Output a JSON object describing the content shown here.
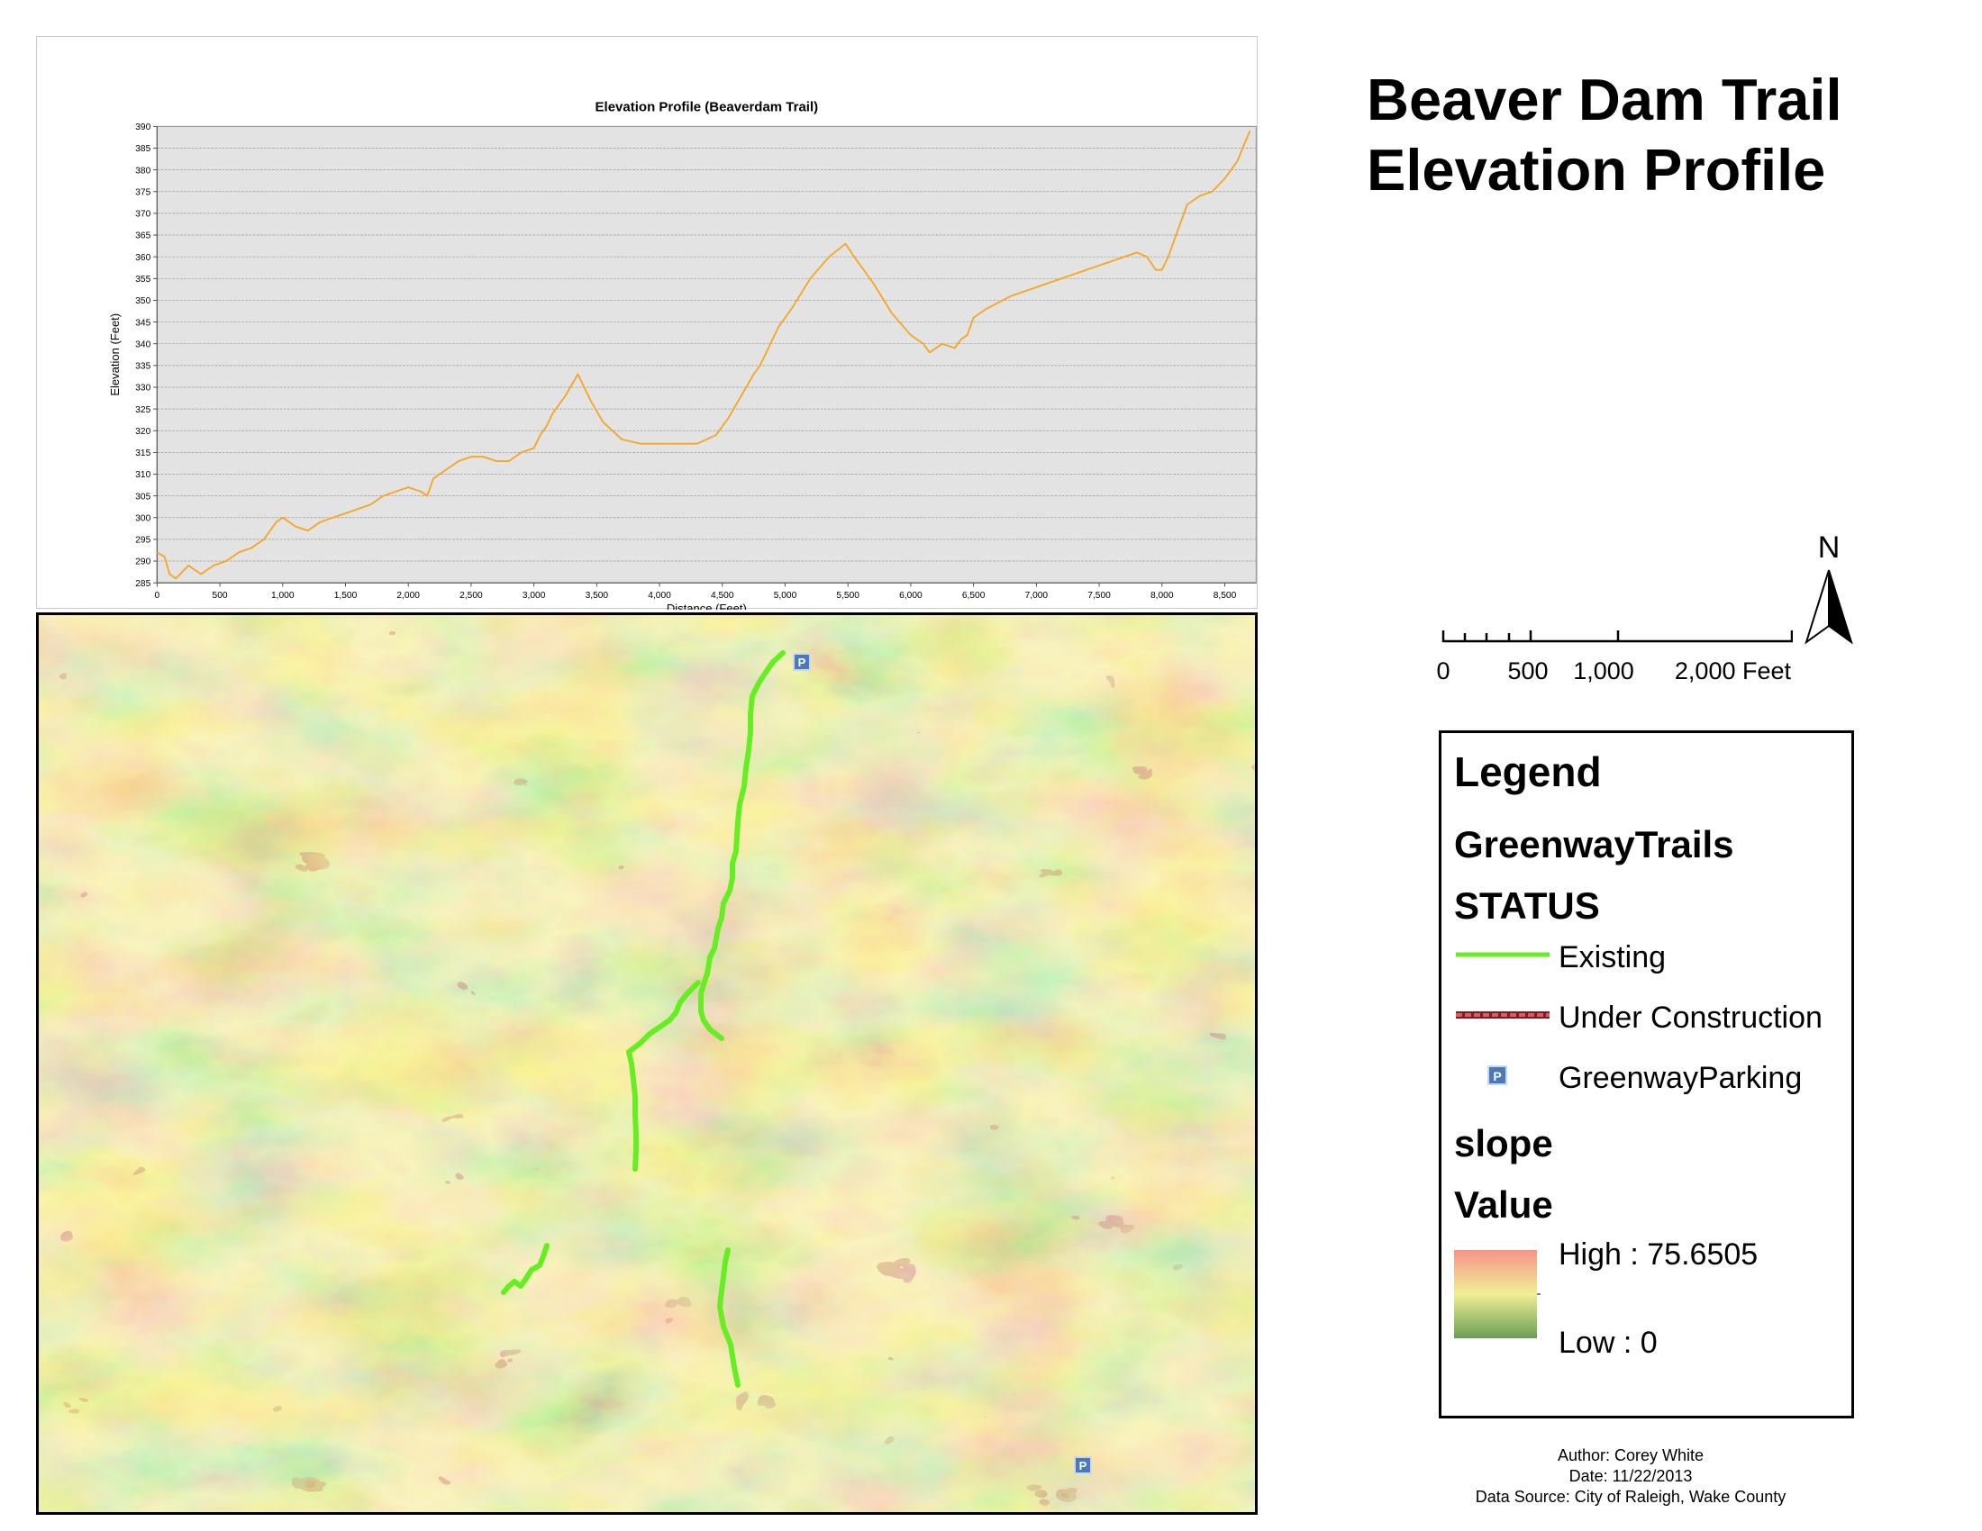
{
  "title": {
    "line1": "Beaver Dam Trail",
    "line2": "Elevation Profile"
  },
  "chart_data": {
    "type": "line",
    "title": "Elevation Profile (Beaverdam Trail)",
    "xlabel": "Distance (Feet)",
    "ylabel": "Elevation (Feet)",
    "xlim": [
      0,
      8750
    ],
    "ylim": [
      285,
      390
    ],
    "xticks": [
      0,
      500,
      1000,
      1500,
      2000,
      2500,
      3000,
      3500,
      4000,
      4500,
      5000,
      5500,
      6000,
      6500,
      7000,
      7500,
      8000,
      8500
    ],
    "xtick_labels": [
      "0",
      "500",
      "1,000",
      "1,500",
      "2,000",
      "2,500",
      "3,000",
      "3,500",
      "4,000",
      "4,500",
      "5,000",
      "5,500",
      "6,000",
      "6,500",
      "7,000",
      "7,500",
      "8,000",
      "8,500"
    ],
    "yticks": [
      285,
      290,
      295,
      300,
      305,
      310,
      315,
      320,
      325,
      330,
      335,
      340,
      345,
      350,
      355,
      360,
      365,
      370,
      375,
      380,
      385,
      390
    ],
    "grid": true,
    "line_color": "#f5a623",
    "x": [
      0,
      60,
      100,
      150,
      250,
      350,
      450,
      550,
      650,
      750,
      850,
      900,
      950,
      1000,
      1100,
      1200,
      1300,
      1400,
      1500,
      1600,
      1700,
      1800,
      1900,
      2000,
      2100,
      2150,
      2200,
      2300,
      2400,
      2500,
      2600,
      2700,
      2800,
      2900,
      3000,
      3050,
      3100,
      3150,
      3250,
      3350,
      3450,
      3550,
      3700,
      3850,
      3950,
      4050,
      4150,
      4300,
      4450,
      4550,
      4650,
      4750,
      4800,
      4850,
      4950,
      5050,
      5200,
      5350,
      5480,
      5550,
      5700,
      5850,
      6000,
      6100,
      6150,
      6250,
      6350,
      6400,
      6450,
      6500,
      6600,
      6800,
      7000,
      7200,
      7400,
      7600,
      7800,
      7880,
      7950,
      8000,
      8050,
      8100,
      8150,
      8200,
      8300,
      8400,
      8500,
      8600,
      8700
    ],
    "y": [
      292,
      291,
      287,
      286,
      289,
      287,
      289,
      290,
      292,
      293,
      295,
      297,
      299,
      300,
      298,
      297,
      299,
      300,
      301,
      302,
      303,
      305,
      306,
      307,
      306,
      305,
      309,
      311,
      313,
      314,
      314,
      313,
      313,
      315,
      316,
      319,
      321,
      324,
      328,
      333,
      327,
      322,
      318,
      317,
      317,
      317,
      317,
      317,
      319,
      323,
      328,
      333,
      335,
      338,
      344,
      348,
      355,
      360,
      363,
      360,
      354,
      347,
      342,
      340,
      338,
      340,
      339,
      341,
      342,
      346,
      348,
      351,
      353,
      355,
      357,
      359,
      361,
      360,
      357,
      357,
      360,
      364,
      368,
      372,
      374,
      375,
      378,
      382,
      389
    ]
  },
  "map": {
    "trail_existing_color": "#66ee22",
    "parking_icon": "parking-icon"
  },
  "scale": {
    "labels": [
      "0",
      "500",
      "1,000",
      "2,000 Feet"
    ]
  },
  "north": {
    "label": "N"
  },
  "legend": {
    "title": "Legend",
    "layer1": "GreenwayTrails",
    "field1": "STATUS",
    "existing": "Existing",
    "under_construction": "Under Construction",
    "parking": "GreenwayParking",
    "layer2": "slope",
    "field2": "Value",
    "high": "High : 75.6505",
    "low": "Low : 0",
    "colors": {
      "existing": "#66ee22",
      "construction": "#cc3344",
      "ramp_high": "#f6938a",
      "ramp_mid": "#f0ef95",
      "ramp_low": "#6a9e55"
    }
  },
  "credits": {
    "author": "Author: Corey White",
    "date": "Date: 11/22/2013",
    "source": "Data Source: City of Raleigh, Wake County"
  }
}
